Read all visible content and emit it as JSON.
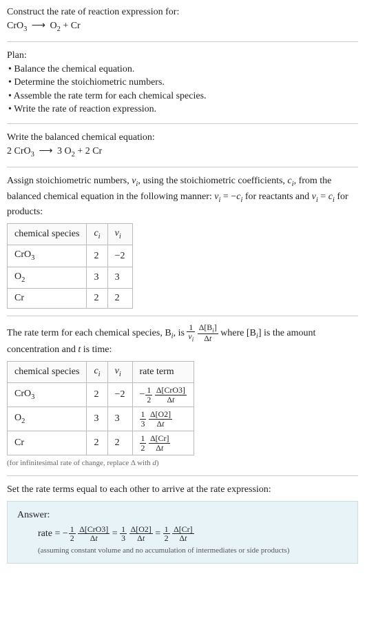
{
  "prompt": {
    "title": "Construct the rate of reaction expression for:",
    "equation_plain": "CrO3 ⟶ O2 + Cr"
  },
  "plan": {
    "heading": "Plan:",
    "items": [
      "Balance the chemical equation.",
      "Determine the stoichiometric numbers.",
      "Assemble the rate term for each chemical species.",
      "Write the rate of reaction expression."
    ]
  },
  "balanced": {
    "heading": "Write the balanced chemical equation:",
    "equation_plain": "2 CrO3 ⟶ 3 O2 + 2 Cr"
  },
  "stoich": {
    "heading_part1": "Assign stoichiometric numbers, ",
    "heading_nu": "ν",
    "heading_i": "i",
    "heading_part2": ", using the stoichiometric coefficients, ",
    "heading_c": "c",
    "heading_part3": ", from the balanced chemical equation in the following manner: ",
    "rel_reactants": " = −",
    "rel_reactants_tail": " for reactants and ",
    "rel_products": " = ",
    "rel_products_tail": " for products:",
    "table": {
      "headers": [
        "chemical species",
        "cᵢ",
        "νᵢ"
      ],
      "rows": [
        {
          "species": "CrO3",
          "c": "2",
          "nu": "−2"
        },
        {
          "species": "O2",
          "c": "3",
          "nu": "3"
        },
        {
          "species": "Cr",
          "c": "2",
          "nu": "2"
        }
      ]
    }
  },
  "rate_term": {
    "heading_a": "The rate term for each chemical species, B",
    "heading_b": ", is ",
    "frac1_num": "1",
    "frac1_den_sym": "ν",
    "frac2_num": "Δ[Bᵢ]",
    "frac2_den": "Δt",
    "heading_c": " where [B",
    "heading_d": "] is the amount concentration and ",
    "heading_t": "t",
    "heading_e": " is time:",
    "table": {
      "headers": [
        "chemical species",
        "cᵢ",
        "νᵢ",
        "rate term"
      ],
      "rows": [
        {
          "species": "CrO3",
          "c": "2",
          "nu": "−2",
          "sign": "−",
          "coef_num": "1",
          "coef_den": "2",
          "delta_num": "Δ[CrO3]",
          "delta_den": "Δt"
        },
        {
          "species": "O2",
          "c": "3",
          "nu": "3",
          "sign": "",
          "coef_num": "1",
          "coef_den": "3",
          "delta_num": "Δ[O2]",
          "delta_den": "Δt"
        },
        {
          "species": "Cr",
          "c": "2",
          "nu": "2",
          "sign": "",
          "coef_num": "1",
          "coef_den": "2",
          "delta_num": "Δ[Cr]",
          "delta_den": "Δt"
        }
      ]
    },
    "note": "(for infinitesimal rate of change, replace Δ with d)"
  },
  "final": {
    "heading": "Set the rate terms equal to each other to arrive at the rate expression:",
    "answer_label": "Answer:",
    "rate_label": "rate = ",
    "terms": [
      {
        "sign": "−",
        "coef_num": "1",
        "coef_den": "2",
        "delta_num": "Δ[CrO3]",
        "delta_den": "Δt"
      },
      {
        "sign": "",
        "coef_num": "1",
        "coef_den": "3",
        "delta_num": "Δ[O2]",
        "delta_den": "Δt"
      },
      {
        "sign": "",
        "coef_num": "1",
        "coef_den": "2",
        "delta_num": "Δ[Cr]",
        "delta_den": "Δt"
      }
    ],
    "eq": " = ",
    "note": "(assuming constant volume and no accumulation of intermediates or side products)"
  },
  "chart_data": {
    "type": "table",
    "tables": [
      {
        "title": "Stoichiometric numbers",
        "headers": [
          "chemical species",
          "c_i",
          "ν_i"
        ],
        "rows": [
          [
            "CrO3",
            2,
            -2
          ],
          [
            "O2",
            3,
            3
          ],
          [
            "Cr",
            2,
            2
          ]
        ]
      },
      {
        "title": "Rate terms",
        "headers": [
          "chemical species",
          "c_i",
          "ν_i",
          "rate term"
        ],
        "rows": [
          [
            "CrO3",
            2,
            -2,
            "-(1/2) Δ[CrO3]/Δt"
          ],
          [
            "O2",
            3,
            3,
            "(1/3) Δ[O2]/Δt"
          ],
          [
            "Cr",
            2,
            2,
            "(1/2) Δ[Cr]/Δt"
          ]
        ]
      }
    ],
    "rate_expression": "rate = -(1/2) Δ[CrO3]/Δt = (1/3) Δ[O2]/Δt = (1/2) Δ[Cr]/Δt"
  }
}
